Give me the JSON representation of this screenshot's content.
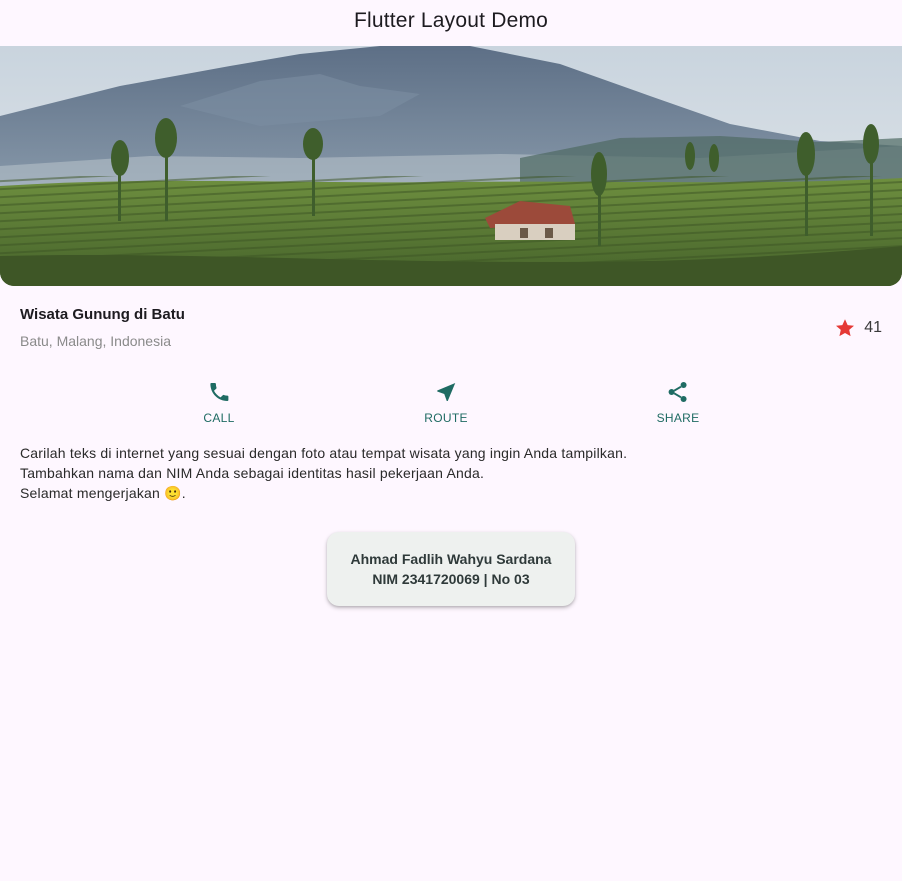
{
  "appbar": {
    "title": "Flutter Layout Demo"
  },
  "hero": {
    "image_icon": "mountain-landscape-image"
  },
  "place": {
    "name": "Wisata Gunung di Batu",
    "location": "Batu, Malang, Indonesia",
    "rating_count": "41",
    "star_icon": "star-icon",
    "star_color": "#e53935"
  },
  "actions": [
    {
      "label": "CALL",
      "icon": "phone-icon"
    },
    {
      "label": "ROUTE",
      "icon": "navigation-arrow-icon"
    },
    {
      "label": "SHARE",
      "icon": "share-icon"
    }
  ],
  "accent_color": "#1f6b63",
  "description": {
    "line1": "Carilah teks di internet yang sesuai dengan foto atau tempat wisata yang ingin Anda tampilkan.",
    "line2": "Tambahkan nama dan NIM Anda sebagai identitas hasil pekerjaan Anda.",
    "line3": "Selamat mengerjakan 🙂."
  },
  "identity_card": {
    "name": "Ahmad Fadlih Wahyu Sardana",
    "nim": "NIM 2341720069 | No 03"
  }
}
